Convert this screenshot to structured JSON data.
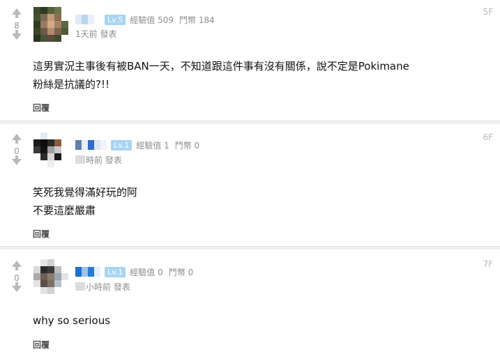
{
  "colors": {
    "level_badge": "#a8d4f2",
    "floor_text": "#b8b8b8",
    "meta_text": "#8d8d8d",
    "separator": "#efefef"
  },
  "icons": {
    "upvote": "arrow-up-icon",
    "downvote": "arrow-down-icon"
  },
  "comments": [
    {
      "floor": "5F",
      "vote_count": "8",
      "level": "Lv.5",
      "exp": "經驗值 509",
      "coins": "鬥幣 184",
      "time": "1天前 發表",
      "lines": [
        "這男實況主事後有被BAN一天，不知道跟這件事有沒有關係，說不定是Pokimane",
        "粉絲是抗議的?!!"
      ],
      "reply_label": "回覆"
    },
    {
      "floor": "6F",
      "vote_count": "0",
      "level": "Lv.1",
      "exp": "經驗值 1",
      "coins": "鬥幣 0",
      "time": "時前 發表",
      "lines": [
        "笑死我覺得滿好玩的阿",
        "不要這麼嚴肅"
      ],
      "reply_label": "回覆"
    },
    {
      "floor": "7F",
      "vote_count": "0",
      "level": "Lv.1",
      "exp": "經驗值 0",
      "coins": "鬥幣 0",
      "time": "小時前 發表",
      "lines": [
        "why so serious"
      ],
      "reply_label": "回覆"
    }
  ]
}
